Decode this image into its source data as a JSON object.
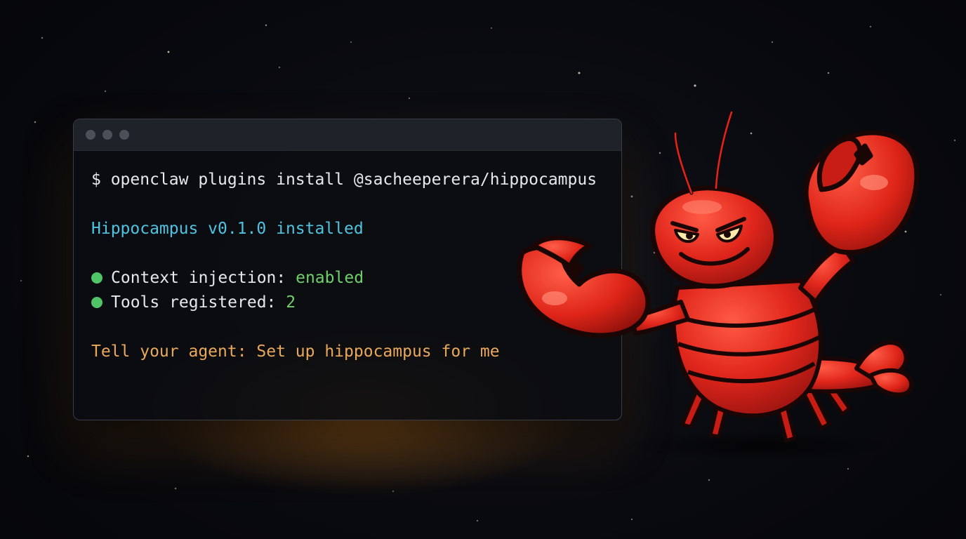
{
  "terminal": {
    "command": "$ openclaw plugins install @sacheeperera/hippocampus",
    "installed_message": "Hippocampus v0.1.0 installed",
    "status": [
      {
        "label": "Context injection: ",
        "value": "enabled"
      },
      {
        "label": "Tools registered: ",
        "value": "2"
      }
    ],
    "instruction": "Tell your agent: Set up hippocampus for me"
  },
  "icons": {
    "window_controls": [
      "window-dot-icon",
      "window-dot-icon",
      "window-dot-icon"
    ],
    "status_bullet": "green-dot-icon",
    "mascot": "lobster-mascot-icon"
  },
  "colors": {
    "background": "#07080c",
    "terminal_bg": "#0c0d11",
    "titlebar": "#1f2228",
    "command_text": "#e6e8ec",
    "installed_text": "#4fc3df",
    "status_value": "#6fcf6d",
    "status_bullet": "#52c468",
    "instruction_text": "#e9a85a",
    "glow": "#d6801a",
    "lobster": "#e0261c"
  }
}
